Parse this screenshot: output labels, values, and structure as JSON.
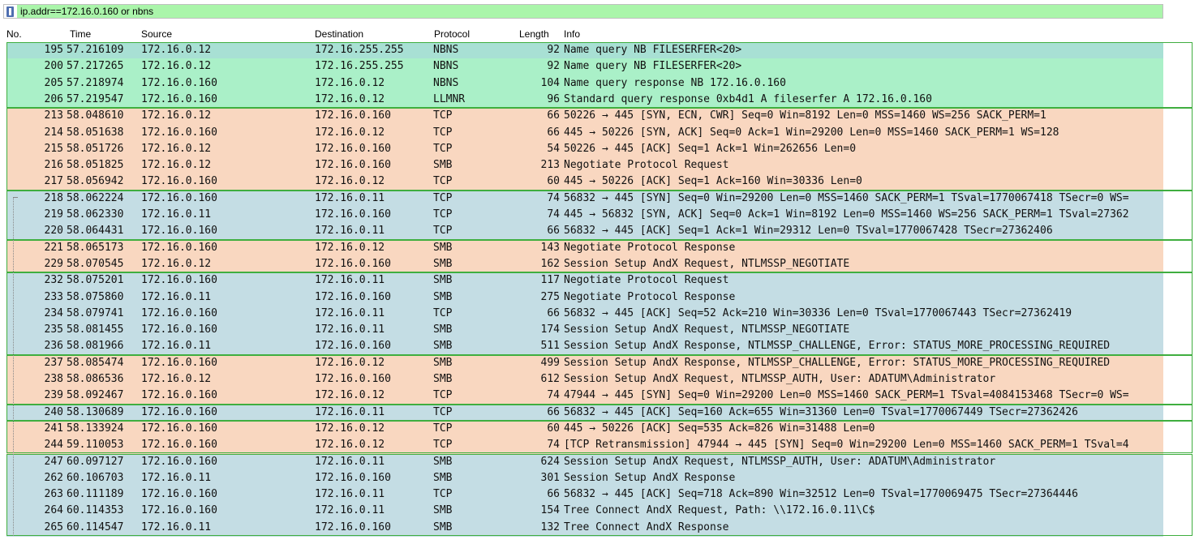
{
  "filter": {
    "text": "ip.addr==172.16.0.160 or nbns"
  },
  "columns": {
    "no": "No.",
    "time": "Time",
    "source": "Source",
    "destination": "Destination",
    "protocol": "Protocol",
    "length": "Length",
    "info": "Info"
  },
  "colors": {
    "green": "#aaf0c8",
    "orange": "#f9d7c0",
    "blue": "#c4dde4",
    "selected": "#a8e0d4",
    "group_border": "#3fae3f"
  },
  "rows": [
    {
      "no": "195",
      "time": "57.216109",
      "src": "172.16.0.12",
      "dst": "172.16.255.255",
      "proto": "NBNS",
      "len": "92",
      "info": "Name query NB FILESERFER<20>",
      "color": "selected"
    },
    {
      "no": "200",
      "time": "57.217265",
      "src": "172.16.0.12",
      "dst": "172.16.255.255",
      "proto": "NBNS",
      "len": "92",
      "info": "Name query NB FILESERFER<20>",
      "color": "green"
    },
    {
      "no": "205",
      "time": "57.218974",
      "src": "172.16.0.160",
      "dst": "172.16.0.12",
      "proto": "NBNS",
      "len": "104",
      "info": "Name query response NB 172.16.0.160",
      "color": "green"
    },
    {
      "no": "206",
      "time": "57.219547",
      "src": "172.16.0.160",
      "dst": "172.16.0.12",
      "proto": "LLMNR",
      "len": "96",
      "info": "Standard query response 0xb4d1 A fileserfer A 172.16.0.160",
      "color": "green"
    },
    {
      "no": "213",
      "time": "58.048610",
      "src": "172.16.0.12",
      "dst": "172.16.0.160",
      "proto": "TCP",
      "len": "66",
      "info": "50226 → 445 [SYN, ECN, CWR] Seq=0 Win=8192 Len=0 MSS=1460 WS=256 SACK_PERM=1",
      "color": "orange"
    },
    {
      "no": "214",
      "time": "58.051638",
      "src": "172.16.0.160",
      "dst": "172.16.0.12",
      "proto": "TCP",
      "len": "66",
      "info": "445 → 50226 [SYN, ACK] Seq=0 Ack=1 Win=29200 Len=0 MSS=1460 SACK_PERM=1 WS=128",
      "color": "orange"
    },
    {
      "no": "215",
      "time": "58.051726",
      "src": "172.16.0.12",
      "dst": "172.16.0.160",
      "proto": "TCP",
      "len": "54",
      "info": "50226 → 445 [ACK] Seq=1 Ack=1 Win=262656 Len=0",
      "color": "orange"
    },
    {
      "no": "216",
      "time": "58.051825",
      "src": "172.16.0.12",
      "dst": "172.16.0.160",
      "proto": "SMB",
      "len": "213",
      "info": "Negotiate Protocol Request",
      "color": "orange"
    },
    {
      "no": "217",
      "time": "58.056942",
      "src": "172.16.0.160",
      "dst": "172.16.0.12",
      "proto": "TCP",
      "len": "60",
      "info": "445 → 50226 [ACK] Seq=1 Ack=160 Win=30336 Len=0",
      "color": "orange"
    },
    {
      "no": "218",
      "time": "58.062224",
      "src": "172.16.0.160",
      "dst": "172.16.0.11",
      "proto": "TCP",
      "len": "74",
      "info": "56832 → 445 [SYN] Seq=0 Win=29200 Len=0 MSS=1460 SACK_PERM=1 TSval=1770067418 TSecr=0 WS=",
      "color": "blue"
    },
    {
      "no": "219",
      "time": "58.062330",
      "src": "172.16.0.11",
      "dst": "172.16.0.160",
      "proto": "TCP",
      "len": "74",
      "info": "445 → 56832 [SYN, ACK] Seq=0 Ack=1 Win=8192 Len=0 MSS=1460 WS=256 SACK_PERM=1 TSval=27362",
      "color": "blue"
    },
    {
      "no": "220",
      "time": "58.064431",
      "src": "172.16.0.160",
      "dst": "172.16.0.11",
      "proto": "TCP",
      "len": "66",
      "info": "56832 → 445 [ACK] Seq=1 Ack=1 Win=29312 Len=0 TSval=1770067428 TSecr=27362406",
      "color": "blue"
    },
    {
      "no": "221",
      "time": "58.065173",
      "src": "172.16.0.160",
      "dst": "172.16.0.12",
      "proto": "SMB",
      "len": "143",
      "info": "Negotiate Protocol Response",
      "color": "orange"
    },
    {
      "no": "229",
      "time": "58.070545",
      "src": "172.16.0.12",
      "dst": "172.16.0.160",
      "proto": "SMB",
      "len": "162",
      "info": "Session Setup AndX Request, NTLMSSP_NEGOTIATE",
      "color": "orange"
    },
    {
      "no": "232",
      "time": "58.075201",
      "src": "172.16.0.160",
      "dst": "172.16.0.11",
      "proto": "SMB",
      "len": "117",
      "info": "Negotiate Protocol Request",
      "color": "blue"
    },
    {
      "no": "233",
      "time": "58.075860",
      "src": "172.16.0.11",
      "dst": "172.16.0.160",
      "proto": "SMB",
      "len": "275",
      "info": "Negotiate Protocol Response",
      "color": "blue"
    },
    {
      "no": "234",
      "time": "58.079741",
      "src": "172.16.0.160",
      "dst": "172.16.0.11",
      "proto": "TCP",
      "len": "66",
      "info": "56832 → 445 [ACK] Seq=52 Ack=210 Win=30336 Len=0 TSval=1770067443 TSecr=27362419",
      "color": "blue"
    },
    {
      "no": "235",
      "time": "58.081455",
      "src": "172.16.0.160",
      "dst": "172.16.0.11",
      "proto": "SMB",
      "len": "174",
      "info": "Session Setup AndX Request, NTLMSSP_NEGOTIATE",
      "color": "blue"
    },
    {
      "no": "236",
      "time": "58.081966",
      "src": "172.16.0.11",
      "dst": "172.16.0.160",
      "proto": "SMB",
      "len": "511",
      "info": "Session Setup AndX Response, NTLMSSP_CHALLENGE, Error: STATUS_MORE_PROCESSING_REQUIRED",
      "color": "blue"
    },
    {
      "no": "237",
      "time": "58.085474",
      "src": "172.16.0.160",
      "dst": "172.16.0.12",
      "proto": "SMB",
      "len": "499",
      "info": "Session Setup AndX Response, NTLMSSP_CHALLENGE, Error: STATUS_MORE_PROCESSING_REQUIRED",
      "color": "orange"
    },
    {
      "no": "238",
      "time": "58.086536",
      "src": "172.16.0.12",
      "dst": "172.16.0.160",
      "proto": "SMB",
      "len": "612",
      "info": "Session Setup AndX Request, NTLMSSP_AUTH, User: ADATUM\\Administrator",
      "color": "orange"
    },
    {
      "no": "239",
      "time": "58.092467",
      "src": "172.16.0.160",
      "dst": "172.16.0.12",
      "proto": "TCP",
      "len": "74",
      "info": "47944 → 445 [SYN] Seq=0 Win=29200 Len=0 MSS=1460 SACK_PERM=1 TSval=4084153468 TSecr=0 WS=",
      "color": "orange"
    },
    {
      "no": "240",
      "time": "58.130689",
      "src": "172.16.0.160",
      "dst": "172.16.0.11",
      "proto": "TCP",
      "len": "66",
      "info": "56832 → 445 [ACK] Seq=160 Ack=655 Win=31360 Len=0 TSval=1770067449 TSecr=27362426",
      "color": "blue"
    },
    {
      "no": "241",
      "time": "58.133924",
      "src": "172.16.0.160",
      "dst": "172.16.0.12",
      "proto": "TCP",
      "len": "60",
      "info": "445 → 50226 [ACK] Seq=535 Ack=826 Win=31488 Len=0",
      "color": "orange"
    },
    {
      "no": "244",
      "time": "59.110053",
      "src": "172.16.0.160",
      "dst": "172.16.0.12",
      "proto": "TCP",
      "len": "74",
      "info": "[TCP Retransmission] 47944 → 445 [SYN] Seq=0 Win=29200 Len=0 MSS=1460 SACK_PERM=1 TSval=4",
      "color": "orange"
    },
    {
      "no": "247",
      "time": "60.097127",
      "src": "172.16.0.160",
      "dst": "172.16.0.11",
      "proto": "SMB",
      "len": "624",
      "info": "Session Setup AndX Request, NTLMSSP_AUTH, User: ADATUM\\Administrator",
      "color": "blue"
    },
    {
      "no": "262",
      "time": "60.106703",
      "src": "172.16.0.11",
      "dst": "172.16.0.160",
      "proto": "SMB",
      "len": "301",
      "info": "Session Setup AndX Response",
      "color": "blue"
    },
    {
      "no": "263",
      "time": "60.111189",
      "src": "172.16.0.160",
      "dst": "172.16.0.11",
      "proto": "TCP",
      "len": "66",
      "info": "56832 → 445 [ACK] Seq=718 Ack=890 Win=32512 Len=0 TSval=1770069475 TSecr=27364446",
      "color": "blue"
    },
    {
      "no": "264",
      "time": "60.114353",
      "src": "172.16.0.160",
      "dst": "172.16.0.11",
      "proto": "SMB",
      "len": "154",
      "info": "Tree Connect AndX Request, Path: \\\\172.16.0.11\\C$",
      "color": "blue"
    },
    {
      "no": "265",
      "time": "60.114547",
      "src": "172.16.0.11",
      "dst": "172.16.0.160",
      "proto": "SMB",
      "len": "132",
      "info": "Tree Connect AndX Response",
      "color": "blue"
    }
  ]
}
